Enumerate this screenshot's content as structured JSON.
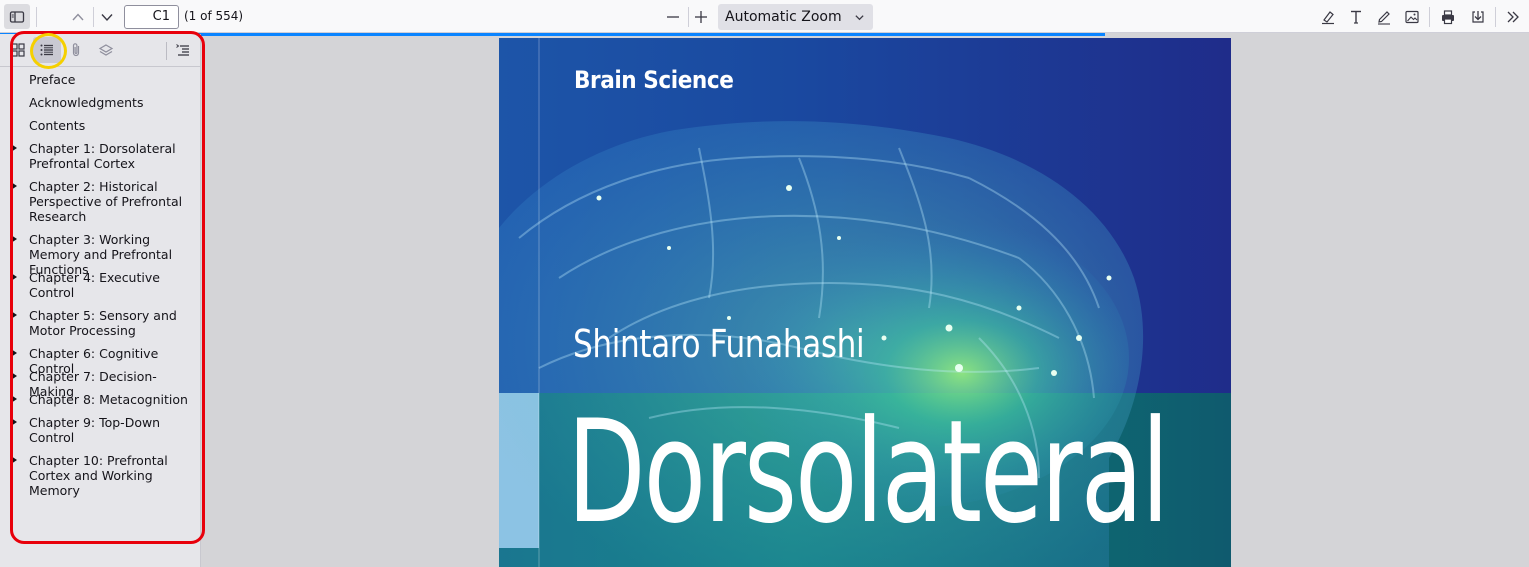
{
  "toolbar": {
    "page_number": "C1",
    "page_count": "(1 of 554)",
    "zoom_value": "Automatic Zoom"
  },
  "sidebar": {
    "outline": [
      {
        "label": "Preface",
        "expandable": false
      },
      {
        "label": "Acknowledgments",
        "expandable": false
      },
      {
        "label": "Contents",
        "expandable": false
      },
      {
        "label": "Chapter 1: Dorsolateral Prefrontal Cortex",
        "expandable": true
      },
      {
        "label": "Chapter 2: Historical Perspective of Prefrontal Research",
        "expandable": true
      },
      {
        "label": "Chapter 3: Working Memory and Prefrontal Functions",
        "expandable": true
      },
      {
        "label": "Chapter 4: Executive Control",
        "expandable": true
      },
      {
        "label": "Chapter 5: Sensory and Motor Processing",
        "expandable": true
      },
      {
        "label": "Chapter 6: Cognitive Control",
        "expandable": true
      },
      {
        "label": "Chapter 7: Decision-Making",
        "expandable": true
      },
      {
        "label": "Chapter 8: Metacognition",
        "expandable": true
      },
      {
        "label": "Chapter 9: Top-Down Control",
        "expandable": true
      },
      {
        "label": "Chapter 10: Prefrontal Cortex and Working Memory",
        "expandable": true
      }
    ]
  },
  "document": {
    "series": "Brain Science",
    "author": "Shintaro Funahashi",
    "title_visible": "Dorsolateral"
  },
  "colors": {
    "highlight_box": "#e8000b",
    "highlight_ring": "#f5d000",
    "progress": "#0a84ff"
  }
}
